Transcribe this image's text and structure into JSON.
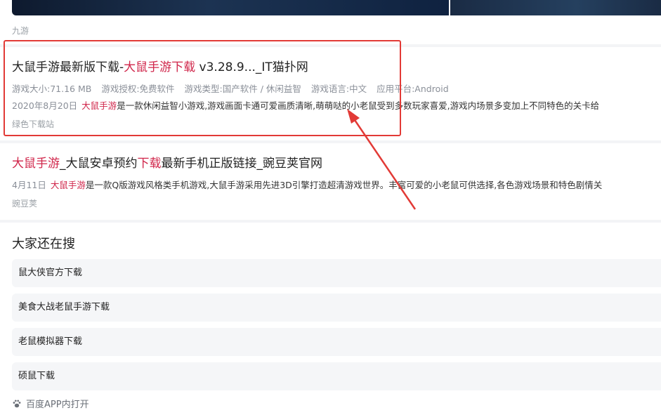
{
  "top_result": {
    "source": "九游"
  },
  "result1": {
    "title_prefix": "大鼠手游最新版下载-",
    "title_highlight": "大鼠手游下载",
    "title_suffix": " v3.28.9..._IT猫扑网",
    "meta": [
      "游戏大小:71.16 MB",
      "游戏授权:免费软件",
      "游戏类型:国产软件 / 休闲益智",
      "游戏语言:中文",
      "应用平台:Android"
    ],
    "date": "2020年8月20日",
    "desc_highlight": "大鼠手游",
    "desc_text": "是一款休闲益智小游戏,游戏画面卡通可爱画质清晰,萌萌哒的小老鼠受到多数玩家喜爱,游戏内场景多变加上不同特色的关卡给",
    "source": "绿色下载站"
  },
  "result2": {
    "title_hl1": "大鼠手游",
    "title_mid": "_大鼠安卓预约",
    "title_hl2": "下载",
    "title_suffix": "最新手机正版链接_豌豆荚官网",
    "date": "4月11日",
    "desc_highlight": "大鼠手游",
    "desc_text": "是一款Q版游戏风格类手机游戏,大鼠手游采用先进3D引擎打造超清游戏世界。丰富可爱的小老鼠可供选择,各色游戏场景和特色剧情关",
    "source": "豌豆荚"
  },
  "also_search": {
    "title": "大家还在搜",
    "items": [
      "鼠大侠官方下载",
      "美食大战老鼠手游下载",
      "老鼠模拟器下载",
      "硕鼠下载"
    ]
  },
  "footer": {
    "open_app": "百度APP内打开",
    "icon": "paw-icon"
  },
  "colors": {
    "highlight": "#d0254a",
    "annotation": "#e23a36"
  }
}
